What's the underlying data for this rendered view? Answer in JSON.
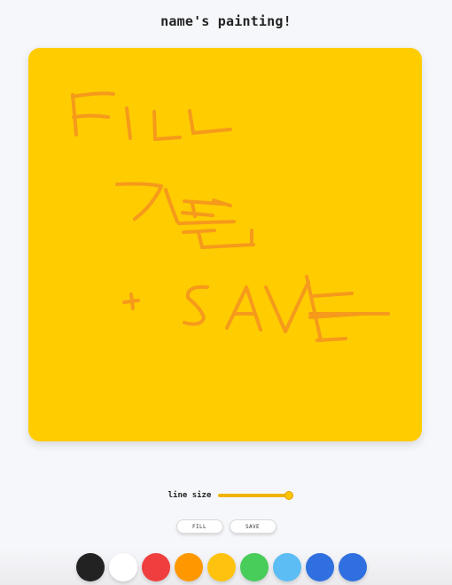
{
  "header": {
    "title": "name's painting!"
  },
  "canvas": {
    "background_color": "#FFCC00",
    "stroke_color": "#F59A1B",
    "strokes": [
      "M 50 53 L 54 98",
      "M 50 55 Q 80 50 96 52",
      "M 51 78 Q 70 75 90 78",
      "M 111 68 L 115 102",
      "M 142 72 L 143 103",
      "M 143 103 L 171 101",
      "M 182 71 L 186 96",
      "M 186 96 L 228 92",
      "M 100 154 Q 130 152 150 156",
      "M 150 156 Q 140 178 120 193",
      "M 155 160 Q 160 176 168 196",
      "M 174 186 L 208 189",
      "M 185 176 L 188 190",
      "M 176 173 L 219 176",
      "M 170 198 L 232 196",
      "M 175 208 L 210 206",
      "M 192 208 L 196 225",
      "M 196 225 L 254 222",
      "M 252 206 L 252 222",
      "M 209 172 L 228 178",
      "M 108 287 L 124 285",
      "M 116 278 L 118 294",
      "M 202 270 Q 178 268 180 282 Q 196 295 198 305 Q 194 315 176 310",
      "M 224 316 L 246 270 L 262 318",
      "M 233 300 L 255 300",
      "M 268 270 L 290 320",
      "M 290 320 L 316 264",
      "M 314 258 L 330 330",
      "M 318 304 L 376 300",
      "M 322 280 L 365 277",
      "M 326 330 L 358 328",
      "M 318 300 L 406 300"
    ]
  },
  "line_size": {
    "label": "line size",
    "value": 1.0
  },
  "actions": {
    "fill_label": "FILL",
    "save_label": "SAVE"
  },
  "palette": {
    "colors": [
      "#222222",
      "#FFFFFF",
      "#F03E3E",
      "#FF9800",
      "#FFC30F",
      "#48CC5A",
      "#5CBDF4",
      "#2F6FE0",
      "#2F6FE0"
    ]
  }
}
